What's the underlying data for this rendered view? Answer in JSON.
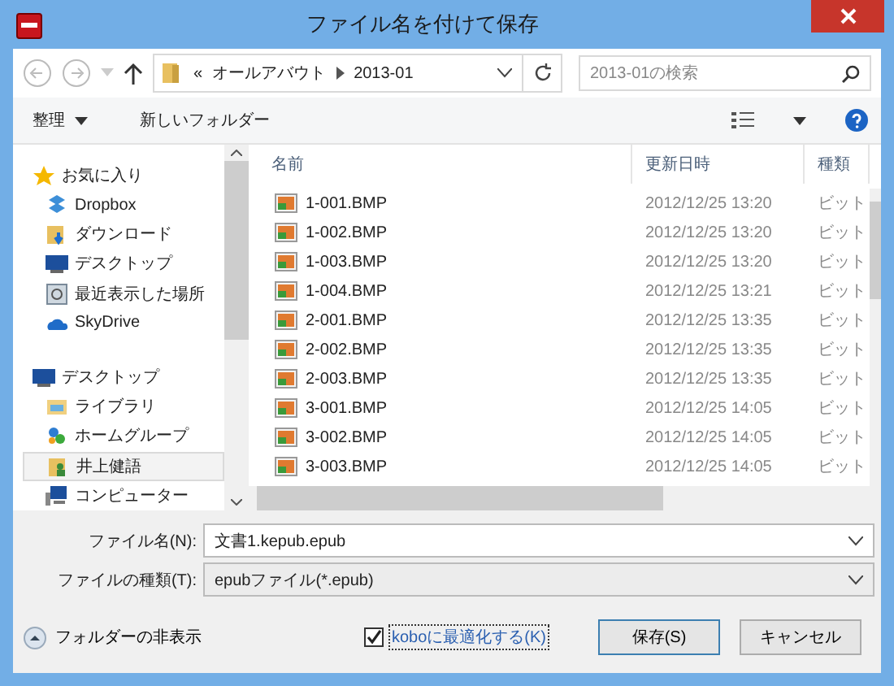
{
  "window": {
    "title": "ファイル名を付けて保存"
  },
  "address": {
    "overflow": "«",
    "segments": [
      "オールアバウト",
      "2013-01"
    ]
  },
  "search": {
    "placeholder": "2013-01の検索"
  },
  "toolbar": {
    "organize": "整理",
    "new_folder": "新しいフォルダー"
  },
  "sidebar": {
    "groups": [
      {
        "label": "お気に入り",
        "children": [
          {
            "label": "Dropbox",
            "selected": false
          },
          {
            "label": "ダウンロード",
            "selected": false
          },
          {
            "label": "デスクトップ",
            "selected": false
          },
          {
            "label": "最近表示した場所",
            "selected": false
          },
          {
            "label": "SkyDrive",
            "selected": false
          }
        ]
      },
      {
        "label": "デスクトップ",
        "children": [
          {
            "label": "ライブラリ",
            "selected": false
          },
          {
            "label": "ホームグループ",
            "selected": false
          },
          {
            "label": "井上健語",
            "selected": true
          },
          {
            "label": "コンピューター",
            "selected": false
          }
        ]
      }
    ]
  },
  "table": {
    "columns": [
      "名前",
      "更新日時",
      "種類"
    ],
    "rows": [
      [
        "1-001.BMP",
        "2012/12/25 13:20",
        "ビット"
      ],
      [
        "1-002.BMP",
        "2012/12/25 13:20",
        "ビット"
      ],
      [
        "1-003.BMP",
        "2012/12/25 13:20",
        "ビット"
      ],
      [
        "1-004.BMP",
        "2012/12/25 13:21",
        "ビット"
      ],
      [
        "2-001.BMP",
        "2012/12/25 13:35",
        "ビット"
      ],
      [
        "2-002.BMP",
        "2012/12/25 13:35",
        "ビット"
      ],
      [
        "2-003.BMP",
        "2012/12/25 13:35",
        "ビット"
      ],
      [
        "3-001.BMP",
        "2012/12/25 14:05",
        "ビット"
      ],
      [
        "3-002.BMP",
        "2012/12/25 14:05",
        "ビット"
      ],
      [
        "3-003.BMP",
        "2012/12/25 14:05",
        "ビット"
      ]
    ]
  },
  "file_name": {
    "label": "ファイル名(N):",
    "value": "文書1.kepub.epub"
  },
  "file_type": {
    "label": "ファイルの種類(T):",
    "value": "epubファイル(*.epub)"
  },
  "hide_folders": "フォルダーの非表示",
  "optimize": {
    "label": "koboに最適化する(K)",
    "checked": true
  },
  "buttons": [
    "保存(S)",
    "キャンセル"
  ]
}
